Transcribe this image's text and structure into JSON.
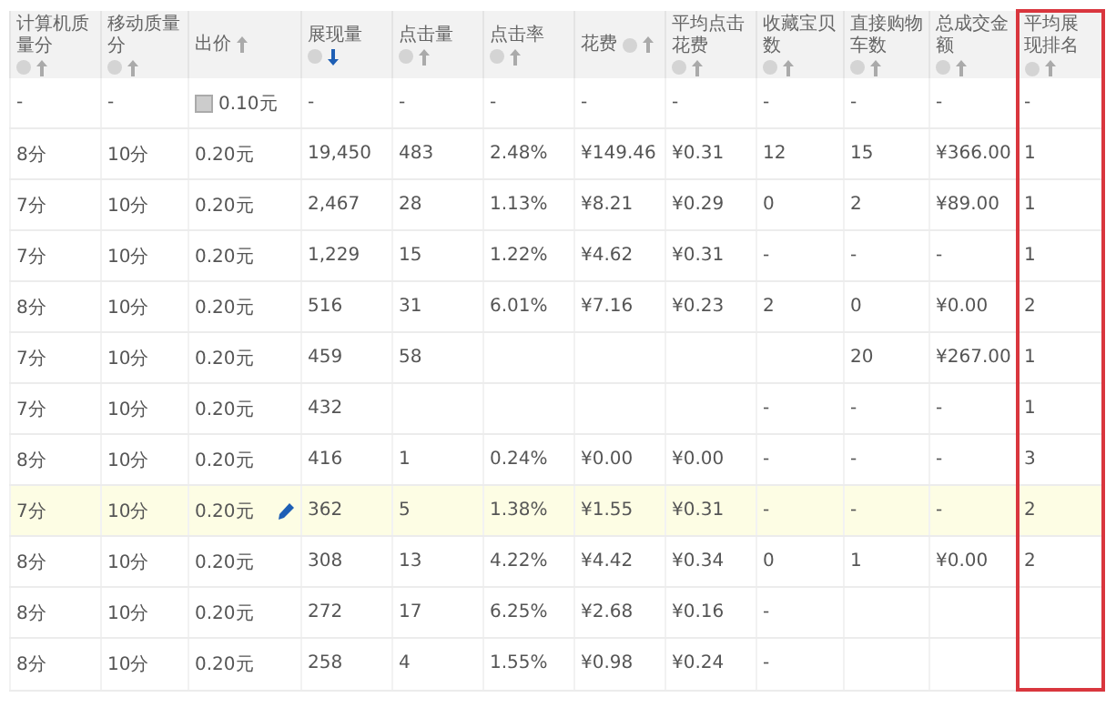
{
  "columns": [
    {
      "label": "计算机质量分",
      "info": true,
      "sorted": false,
      "outlined": false
    },
    {
      "label": "移动质量分",
      "info": true,
      "sorted": false,
      "outlined": false
    },
    {
      "label": "出价",
      "info": false,
      "sorted": false,
      "outlined": false
    },
    {
      "label": "展现量",
      "info": true,
      "sorted": true,
      "outlined": false
    },
    {
      "label": "点击量",
      "info": true,
      "sorted": false,
      "outlined": false
    },
    {
      "label": "点击率",
      "info": true,
      "sorted": false,
      "outlined": false
    },
    {
      "label": "花费",
      "info": true,
      "sorted": false,
      "outlined": false
    },
    {
      "label": "平均点击花费",
      "info": true,
      "sorted": false,
      "outlined": false
    },
    {
      "label": "收藏宝贝数",
      "info": true,
      "sorted": false,
      "outlined": false
    },
    {
      "label": "直接购物车数",
      "info": true,
      "sorted": false,
      "outlined": false
    },
    {
      "label": "总成交金额",
      "info": true,
      "sorted": false,
      "outlined": false
    },
    {
      "label": "平均展现排名",
      "info": true,
      "sorted": false,
      "outlined": true
    }
  ],
  "rows": [
    {
      "kind": "default",
      "selected": false,
      "cells": [
        "-",
        "-",
        "0.10元",
        "-",
        "-",
        "-",
        "-",
        "-",
        "-",
        "-",
        "-",
        "-"
      ]
    },
    {
      "kind": "data",
      "selected": false,
      "cells": [
        "8分",
        "10分",
        "0.20元",
        "19,450",
        "483",
        "2.48%",
        "¥149.46",
        "¥0.31",
        "12",
        "15",
        "¥366.00",
        "1"
      ]
    },
    {
      "kind": "data",
      "selected": false,
      "cells": [
        "7分",
        "10分",
        "0.20元",
        "2,467",
        "28",
        "1.13%",
        "¥8.21",
        "¥0.29",
        "0",
        "2",
        "¥89.00",
        "1"
      ]
    },
    {
      "kind": "data",
      "selected": false,
      "cells": [
        "7分",
        "10分",
        "0.20元",
        "1,229",
        "15",
        "1.22%",
        "¥4.62",
        "¥0.31",
        "-",
        "-",
        "-",
        "1"
      ]
    },
    {
      "kind": "data",
      "selected": false,
      "cells": [
        "8分",
        "10分",
        "0.20元",
        "516",
        "31",
        "6.01%",
        "¥7.16",
        "¥0.23",
        "2",
        "0",
        "¥0.00",
        "2"
      ]
    },
    {
      "kind": "data",
      "selected": false,
      "cells": [
        "7分",
        "10分",
        "0.20元",
        "459",
        "58",
        null,
        null,
        null,
        null,
        "20",
        "¥267.00",
        "1"
      ]
    },
    {
      "kind": "data",
      "selected": false,
      "cells": [
        "7分",
        "10分",
        "0.20元",
        "432",
        null,
        null,
        null,
        null,
        "-",
        "-",
        "-",
        "1"
      ]
    },
    {
      "kind": "data",
      "selected": false,
      "cells": [
        "8分",
        "10分",
        "0.20元",
        "416",
        "1",
        "0.24%",
        "¥0.00",
        "¥0.00",
        "-",
        "-",
        "-",
        "3"
      ]
    },
    {
      "kind": "data",
      "selected": true,
      "cells": [
        "7分",
        "10分",
        "0.20元",
        "362",
        "5",
        "1.38%",
        "¥1.55",
        "¥0.31",
        "-",
        "-",
        "-",
        "2"
      ]
    },
    {
      "kind": "data",
      "selected": false,
      "cells": [
        "8分",
        "10分",
        "0.20元",
        "308",
        "13",
        "4.22%",
        "¥4.42",
        "¥0.34",
        "0",
        "1",
        "¥0.00",
        "2"
      ]
    },
    {
      "kind": "data",
      "selected": false,
      "cells": [
        "8分",
        "10分",
        "0.20元",
        "272",
        "17",
        "6.25%",
        "¥2.68",
        "¥0.16",
        "-",
        null,
        null,
        null
      ]
    },
    {
      "kind": "data",
      "selected": false,
      "cells": [
        "8分",
        "10分",
        "0.20元",
        "258",
        "4",
        "1.55%",
        "¥0.98",
        "¥0.24",
        "-",
        null,
        null,
        null
      ]
    }
  ]
}
